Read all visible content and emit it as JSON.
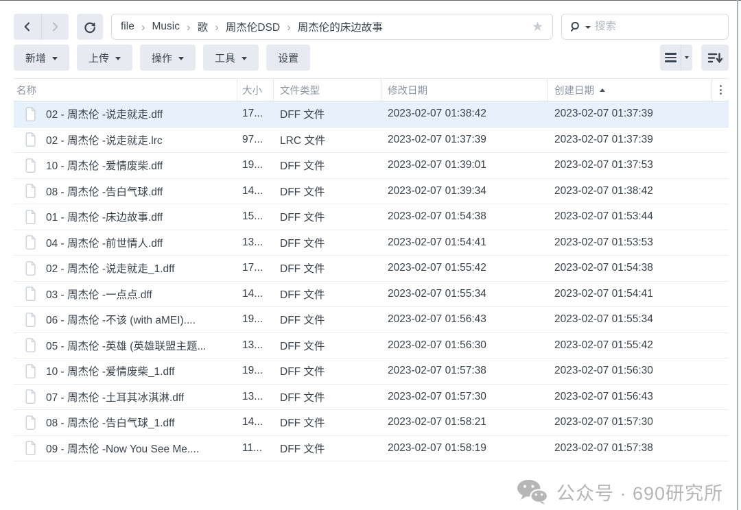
{
  "colors": {
    "selected_row_bg": "#e7f1fc",
    "button_bg": "#e7ebf1",
    "header_text": "#8d96a4",
    "row_text": "#39424d",
    "watermark_gray": "#b6b6b6"
  },
  "nav": {
    "back_icon": "chevron-left-icon",
    "forward_icon": "chevron-right-icon",
    "refresh_icon": "refresh-icon"
  },
  "breadcrumb": {
    "segments": [
      "file",
      "Music",
      "歌",
      "周杰伦DSD",
      "周杰伦的床边故事"
    ],
    "star_icon": "star-icon",
    "star_glyph": "★"
  },
  "search": {
    "placeholder": "搜索",
    "icon": "search-icon"
  },
  "toolbar": {
    "buttons": [
      {
        "label": "新增",
        "dropdown": true
      },
      {
        "label": "上传",
        "dropdown": true
      },
      {
        "label": "操作",
        "dropdown": true
      },
      {
        "label": "工具",
        "dropdown": true
      },
      {
        "label": "设置",
        "dropdown": false
      }
    ]
  },
  "view_controls": {
    "view_mode_icon": "list-view-icon",
    "sort_icon": "sort-order-icon"
  },
  "table": {
    "columns": [
      {
        "label": "名称"
      },
      {
        "label": "大小"
      },
      {
        "label": "文件类型"
      },
      {
        "label": "修改日期"
      },
      {
        "label": "创建日期",
        "sorted": "asc"
      }
    ],
    "rows": [
      {
        "name": "02 - 周杰伦 -说走就走.dff",
        "size": "17...",
        "type": "DFF 文件",
        "modified": "2023-02-07 01:38:42",
        "created": "2023-02-07 01:37:39",
        "selected": true
      },
      {
        "name": "02 - 周杰伦 -说走就走.lrc",
        "size": "97...",
        "type": "LRC 文件",
        "modified": "2023-02-07 01:37:39",
        "created": "2023-02-07 01:37:39"
      },
      {
        "name": "10 - 周杰伦 -爱情废柴.dff",
        "size": "19...",
        "type": "DFF 文件",
        "modified": "2023-02-07 01:39:01",
        "created": "2023-02-07 01:37:53"
      },
      {
        "name": "08 - 周杰伦 -告白气球.dff",
        "size": "14...",
        "type": "DFF 文件",
        "modified": "2023-02-07 01:39:34",
        "created": "2023-02-07 01:38:42"
      },
      {
        "name": "01 - 周杰伦 -床边故事.dff",
        "size": "15...",
        "type": "DFF 文件",
        "modified": "2023-02-07 01:54:38",
        "created": "2023-02-07 01:53:44"
      },
      {
        "name": "04 - 周杰伦 -前世情人.dff",
        "size": "13...",
        "type": "DFF 文件",
        "modified": "2023-02-07 01:54:41",
        "created": "2023-02-07 01:53:53"
      },
      {
        "name": "02 - 周杰伦 -说走就走_1.dff",
        "size": "17...",
        "type": "DFF 文件",
        "modified": "2023-02-07 01:55:42",
        "created": "2023-02-07 01:54:38"
      },
      {
        "name": "03 - 周杰伦 -一点点.dff",
        "size": "14...",
        "type": "DFF 文件",
        "modified": "2023-02-07 01:55:34",
        "created": "2023-02-07 01:54:41"
      },
      {
        "name": "06 - 周杰伦 -不该 (with aMEI)....",
        "size": "19...",
        "type": "DFF 文件",
        "modified": "2023-02-07 01:56:43",
        "created": "2023-02-07 01:55:34"
      },
      {
        "name": "05 - 周杰伦 -英雄 (英雄联盟主题...",
        "size": "13...",
        "type": "DFF 文件",
        "modified": "2023-02-07 01:56:30",
        "created": "2023-02-07 01:55:42"
      },
      {
        "name": "10 - 周杰伦 -爱情废柴_1.dff",
        "size": "19...",
        "type": "DFF 文件",
        "modified": "2023-02-07 01:57:38",
        "created": "2023-02-07 01:56:30"
      },
      {
        "name": "07 - 周杰伦 -土耳其冰淇淋.dff",
        "size": "13...",
        "type": "DFF 文件",
        "modified": "2023-02-07 01:57:30",
        "created": "2023-02-07 01:56:43"
      },
      {
        "name": "08 - 周杰伦 -告白气球_1.dff",
        "size": "14...",
        "type": "DFF 文件",
        "modified": "2023-02-07 01:58:21",
        "created": "2023-02-07 01:57:30"
      },
      {
        "name": "09 - 周杰伦 -Now You See Me....",
        "size": "11...",
        "type": "DFF 文件",
        "modified": "2023-02-07 01:58:19",
        "created": "2023-02-07 01:57:38"
      }
    ]
  },
  "watermark": {
    "text": "公众号 · 690研究所",
    "icon": "wechat-icon"
  }
}
